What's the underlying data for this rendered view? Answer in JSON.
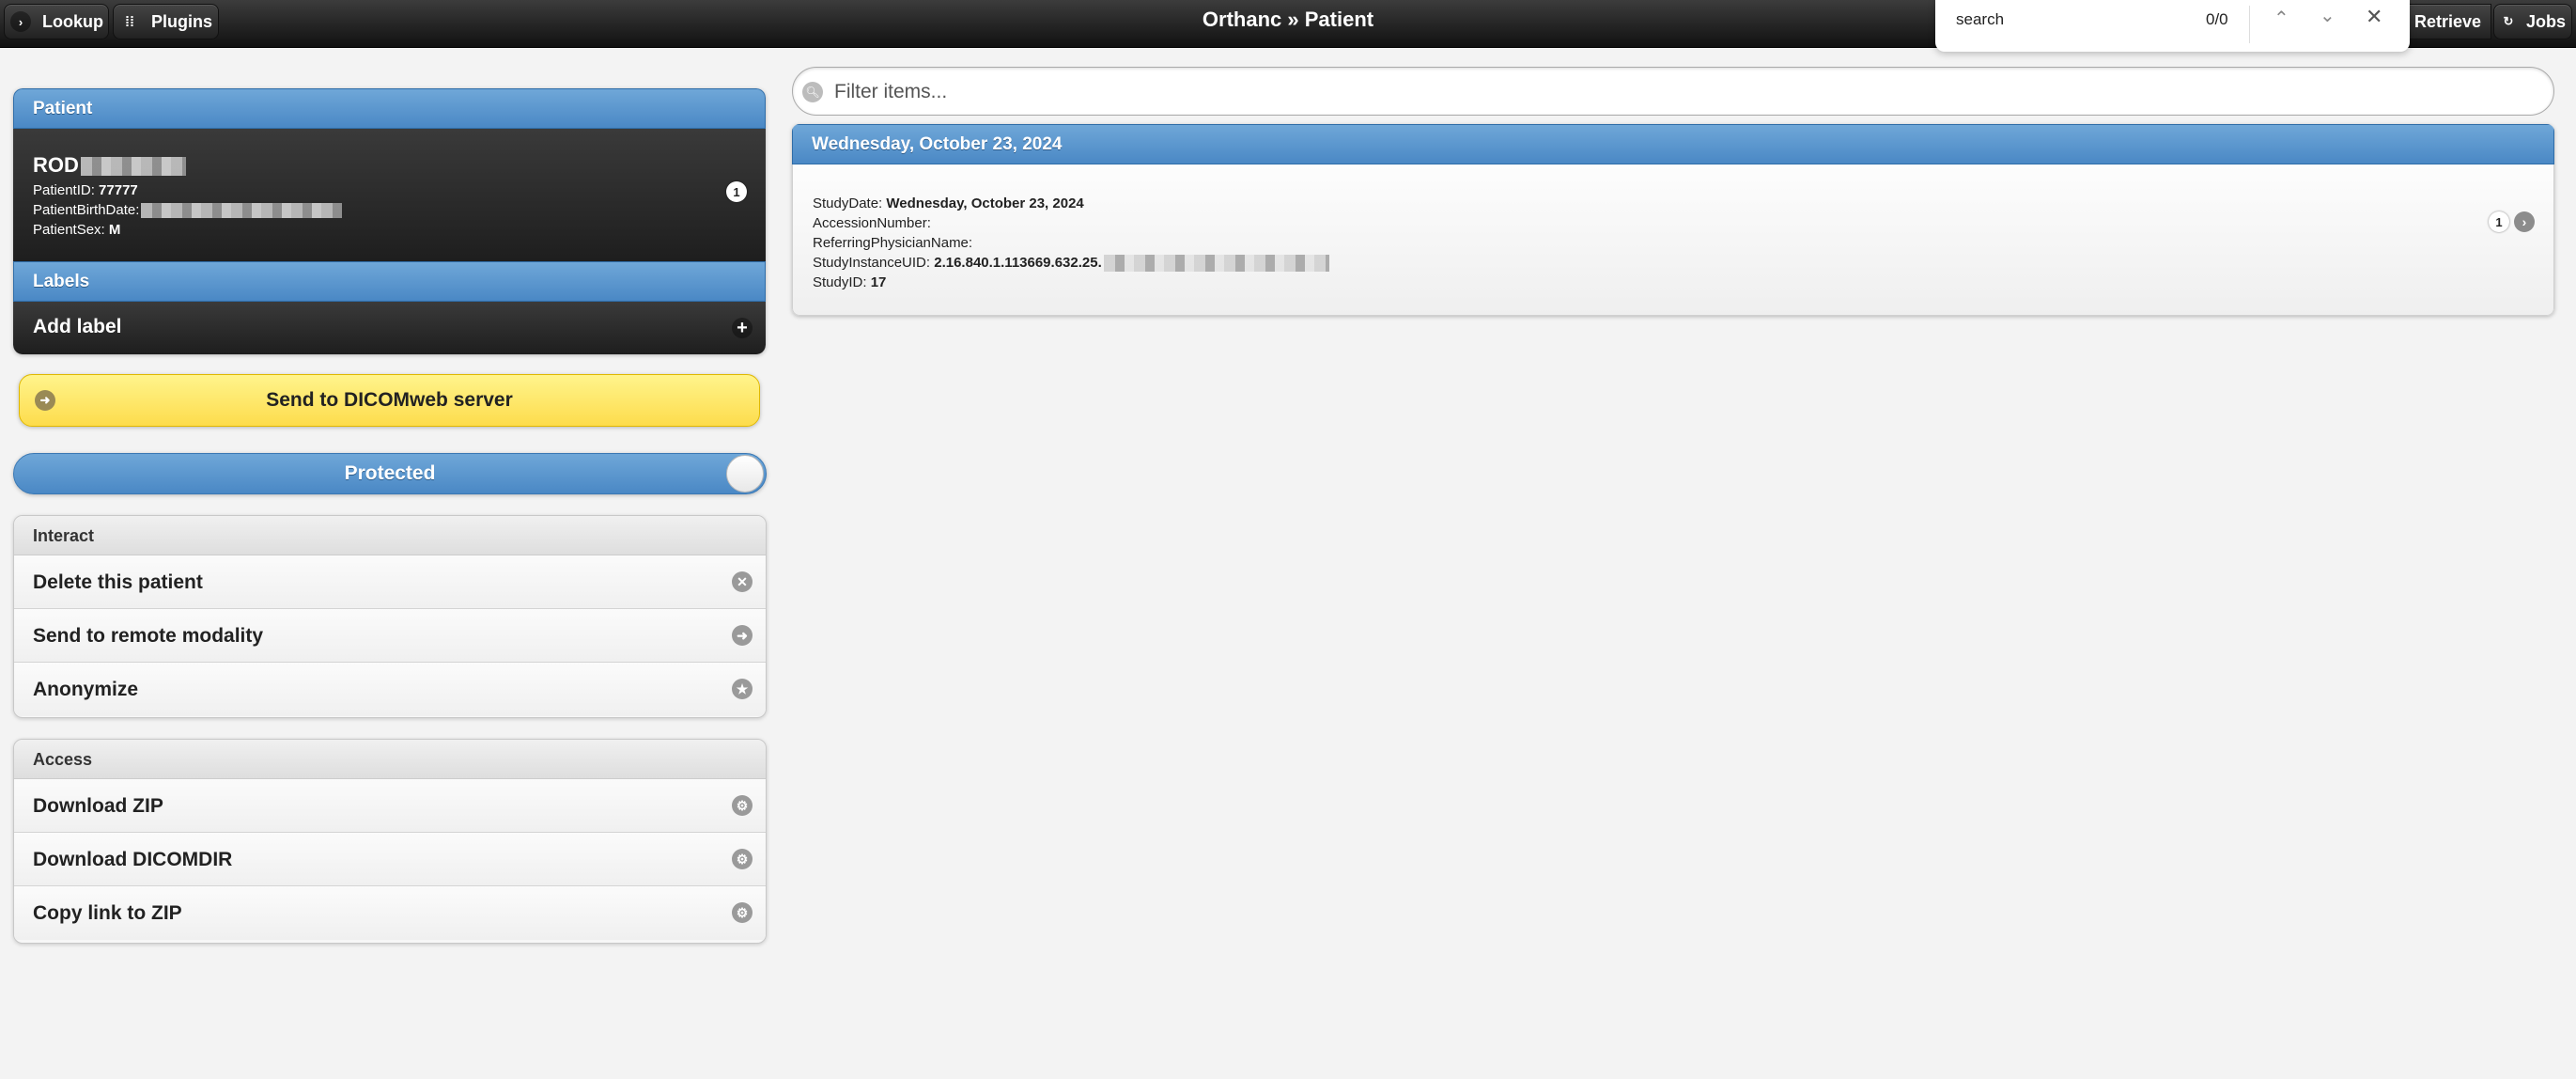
{
  "header": {
    "title": "Orthanc » Patient",
    "lookup_label": "Lookup",
    "plugins_label": "Plugins",
    "retrieve_label": "Retrieve",
    "jobs_label": "Jobs"
  },
  "findbar": {
    "query": "search",
    "count": "0/0"
  },
  "patient": {
    "header": "Patient",
    "name": "ROD",
    "id_label": "PatientID:",
    "id_value": "77777",
    "birth_label": "PatientBirthDate:",
    "birth_value": "",
    "sex_label": "PatientSex:",
    "sex_value": "M",
    "study_count": "1"
  },
  "labels": {
    "header": "Labels",
    "add_label": "Add label"
  },
  "dicomweb_button": "Send to DICOMweb server",
  "protected_toggle": {
    "label": "Protected",
    "checked": true
  },
  "interact": {
    "header": "Interact",
    "items": [
      {
        "label": "Delete this patient"
      },
      {
        "label": "Send to remote modality"
      },
      {
        "label": "Anonymize"
      }
    ]
  },
  "access": {
    "header": "Access",
    "items": [
      {
        "label": "Download ZIP"
      },
      {
        "label": "Download DICOMDIR"
      },
      {
        "label": "Copy link to ZIP"
      }
    ]
  },
  "filter": {
    "placeholder": "Filter items..."
  },
  "study": {
    "header": "Wednesday, October 23, 2024",
    "date_label": "StudyDate:",
    "date_value": "Wednesday, October 23, 2024",
    "accession_label": "AccessionNumber:",
    "referring_label": "ReferringPhysicianName:",
    "uid_label": "StudyInstanceUID:",
    "uid_value": "2.16.840.1.113669.632.25.",
    "studyid_label": "StudyID:",
    "studyid_value": "17",
    "series_count": "1"
  },
  "colors": {
    "accent_blue": "#4a88c5",
    "header_dark": "#1e1e1e",
    "button_yellow": "#fddc4c"
  }
}
